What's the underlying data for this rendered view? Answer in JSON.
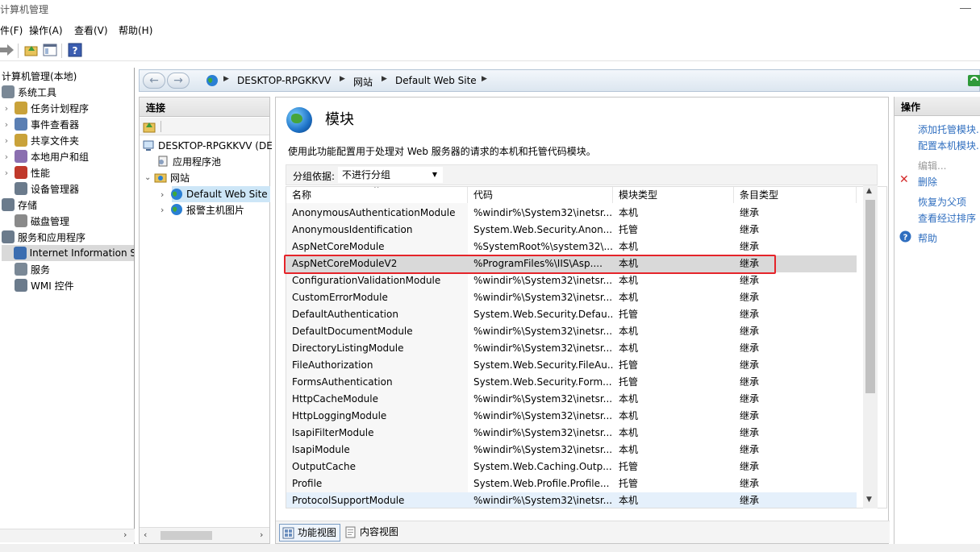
{
  "window": {
    "title": "计算机管理"
  },
  "menubar": [
    "件(F)",
    "操作(A)",
    "查看(V)",
    "帮助(H)"
  ],
  "tree": {
    "root": "计算机管理(本地)",
    "items": [
      {
        "label": "系统工具",
        "level": 0,
        "expander": ""
      },
      {
        "label": "任务计划程序",
        "level": 1,
        "expander": "›"
      },
      {
        "label": "事件查看器",
        "level": 1,
        "expander": "›"
      },
      {
        "label": "共享文件夹",
        "level": 1,
        "expander": "›"
      },
      {
        "label": "本地用户和组",
        "level": 1,
        "expander": "›"
      },
      {
        "label": "性能",
        "level": 1,
        "expander": "›"
      },
      {
        "label": "设备管理器",
        "level": 1,
        "expander": ""
      },
      {
        "label": "存储",
        "level": 0,
        "expander": ""
      },
      {
        "label": "磁盘管理",
        "level": 1,
        "expander": ""
      },
      {
        "label": "服务和应用程序",
        "level": 0,
        "expander": ""
      },
      {
        "label": "Internet Information S",
        "level": 1,
        "expander": ""
      },
      {
        "label": "服务",
        "level": 1,
        "expander": ""
      },
      {
        "label": "WMI 控件",
        "level": 1,
        "expander": ""
      }
    ]
  },
  "address": {
    "crumbs": [
      "DESKTOP-RPGKKVV",
      "网站",
      "Default Web Site"
    ]
  },
  "connections": {
    "header": "连接",
    "items": [
      {
        "label": "DESKTOP-RPGKKVV (DE"
      },
      {
        "label": "应用程序池"
      },
      {
        "label": "网站"
      },
      {
        "label": "Default Web Site"
      },
      {
        "label": "报警主机图片"
      }
    ]
  },
  "main": {
    "title": "模块",
    "description": "使用此功能配置用于处理对 Web 服务器的请求的本机和托管代码模块。",
    "group_label": "分组依据:",
    "group_value": "不进行分组",
    "columns": [
      "名称",
      "代码",
      "模块类型",
      "条目类型"
    ],
    "rows": [
      [
        "AnonymousAuthenticationModule",
        "%windir%\\System32\\inetsr...",
        "本机",
        "继承"
      ],
      [
        "AnonymousIdentification",
        "System.Web.Security.Anon...",
        "托管",
        "继承"
      ],
      [
        "AspNetCoreModule",
        "%SystemRoot%\\system32\\...",
        "本机",
        "继承"
      ],
      [
        "AspNetCoreModuleV2",
        "%ProgramFiles%\\IIS\\Asp....",
        "本机",
        "继承"
      ],
      [
        "ConfigurationValidationModule",
        "%windir%\\System32\\inetsr...",
        "本机",
        "继承"
      ],
      [
        "CustomErrorModule",
        "%windir%\\System32\\inetsr...",
        "本机",
        "继承"
      ],
      [
        "DefaultAuthentication",
        "System.Web.Security.Defau...",
        "托管",
        "继承"
      ],
      [
        "DefaultDocumentModule",
        "%windir%\\System32\\inetsr...",
        "本机",
        "继承"
      ],
      [
        "DirectoryListingModule",
        "%windir%\\System32\\inetsr...",
        "本机",
        "继承"
      ],
      [
        "FileAuthorization",
        "System.Web.Security.FileAu...",
        "托管",
        "继承"
      ],
      [
        "FormsAuthentication",
        "System.Web.Security.Form...",
        "托管",
        "继承"
      ],
      [
        "HttpCacheModule",
        "%windir%\\System32\\inetsr...",
        "本机",
        "继承"
      ],
      [
        "HttpLoggingModule",
        "%windir%\\System32\\inetsr...",
        "本机",
        "继承"
      ],
      [
        "IsapiFilterModule",
        "%windir%\\System32\\inetsr...",
        "本机",
        "继承"
      ],
      [
        "IsapiModule",
        "%windir%\\System32\\inetsr...",
        "本机",
        "继承"
      ],
      [
        "OutputCache",
        "System.Web.Caching.Outp...",
        "托管",
        "继承"
      ],
      [
        "Profile",
        "System.Web.Profile.Profile...",
        "托管",
        "继承"
      ],
      [
        "ProtocolSupportModule",
        "%windir%\\System32\\inetsr...",
        "本机",
        "继承"
      ]
    ]
  },
  "views": {
    "feature": "功能视图",
    "content": "内容视图"
  },
  "actions": {
    "header": "操作",
    "add_managed": "添加托管模块...",
    "config_native": "配置本机模块...",
    "edit": "编辑...",
    "delete": "删除",
    "revert": "恢复为父项",
    "view_sorted": "查看经过排序",
    "help": "帮助"
  },
  "colors": {
    "highlight": "#e5242a",
    "link": "#2f6ebf",
    "selected_row": "#d9d9d9"
  }
}
